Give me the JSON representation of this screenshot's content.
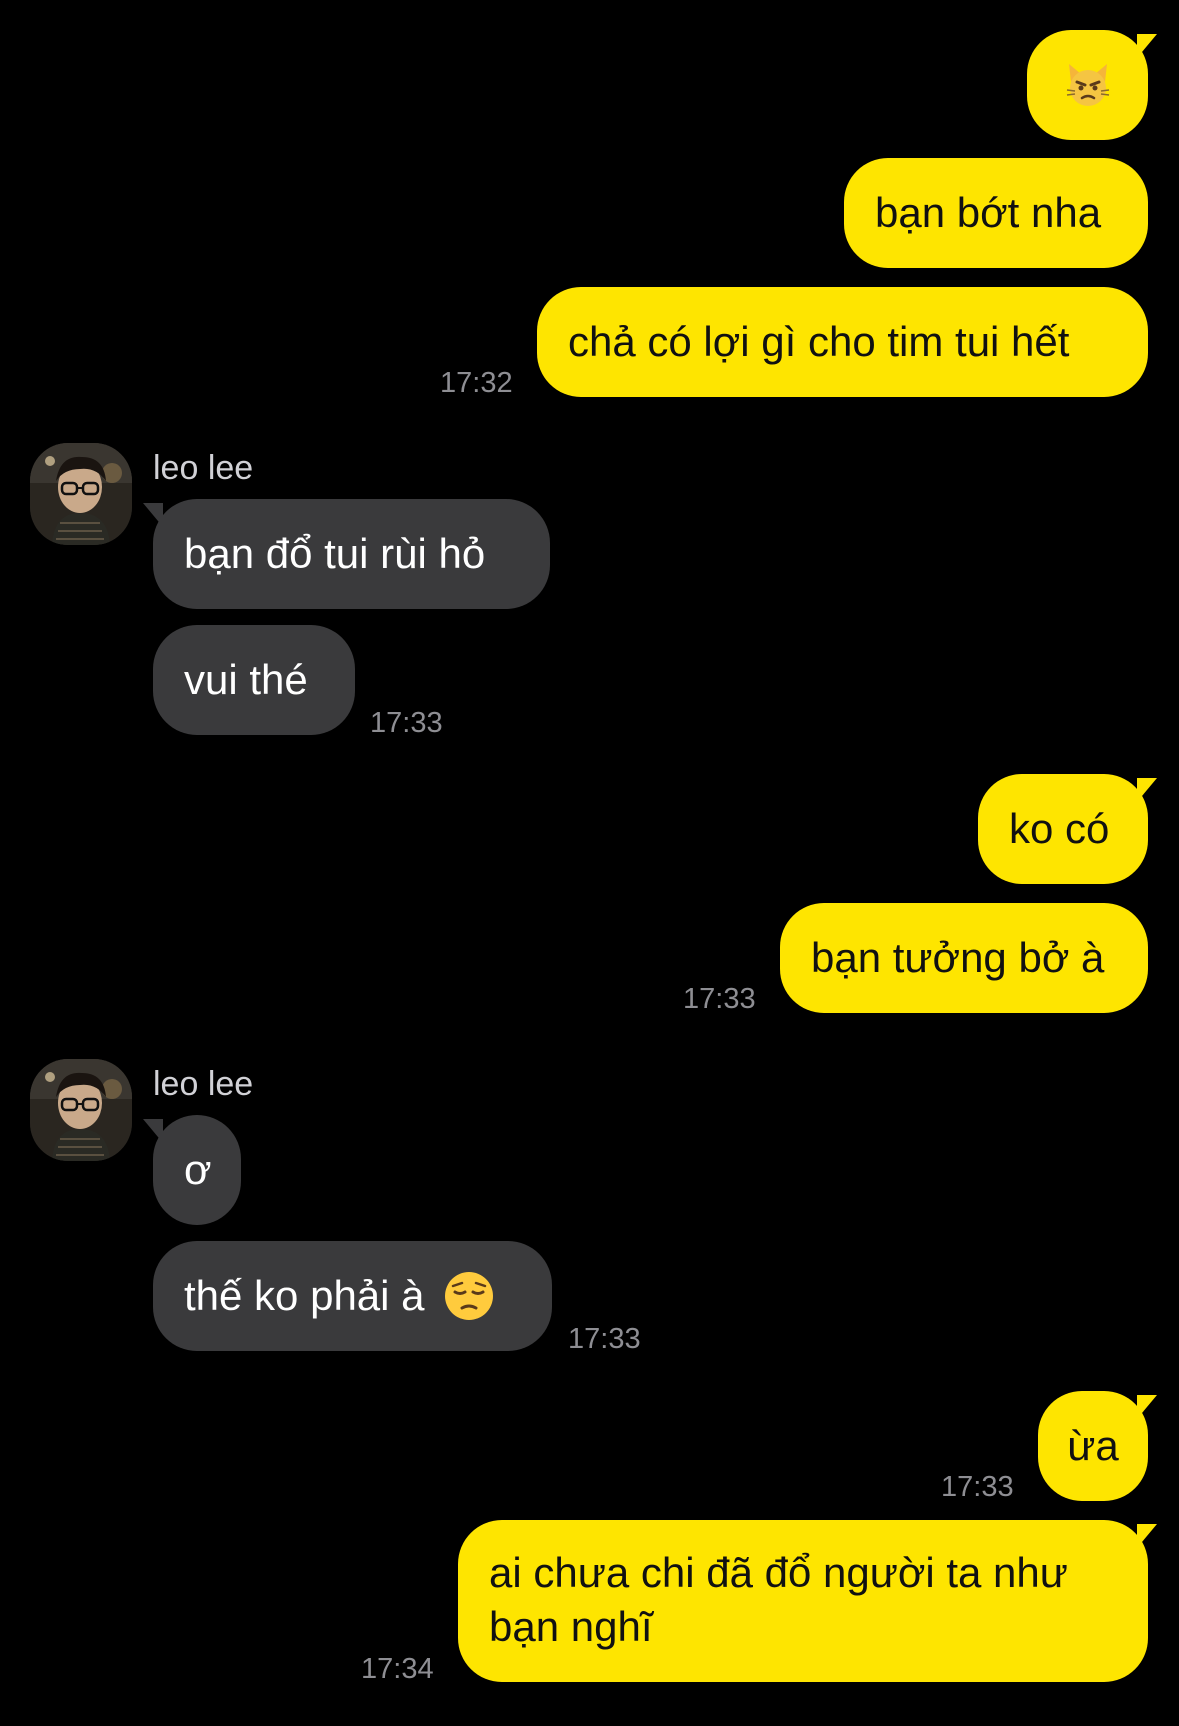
{
  "conversation": {
    "messages": [
      {
        "direction": "outgoing",
        "text": "",
        "emoji": "pouting-cat-emoji"
      },
      {
        "direction": "outgoing",
        "text": "bạn bớt nha"
      },
      {
        "direction": "outgoing",
        "text": "chả có lợi gì cho tim tui hết",
        "time": "17:32"
      },
      {
        "direction": "incoming",
        "sender": "leo lee",
        "text": "bạn đổ tui rùi hỏ"
      },
      {
        "direction": "incoming",
        "text": "vui thé",
        "time": "17:33"
      },
      {
        "direction": "outgoing",
        "text": "ko có"
      },
      {
        "direction": "outgoing",
        "text": "bạn tưởng bở à",
        "time": "17:33"
      },
      {
        "direction": "incoming",
        "sender": "leo lee",
        "text": "ơ"
      },
      {
        "direction": "incoming",
        "text": "thế ko phải à",
        "emoji": "pensive-face-emoji",
        "time": "17:33"
      },
      {
        "direction": "outgoing",
        "text": "ừa",
        "time": "17:33"
      },
      {
        "direction": "outgoing",
        "text": "ai chưa chi đã đổ người ta như bạn nghĩ",
        "time": "17:34"
      }
    ]
  },
  "colors": {
    "background": "#000000",
    "outgoing_bubble": "#FEE500",
    "incoming_bubble": "#3A3A3C",
    "timestamp": "#8E8E93"
  }
}
